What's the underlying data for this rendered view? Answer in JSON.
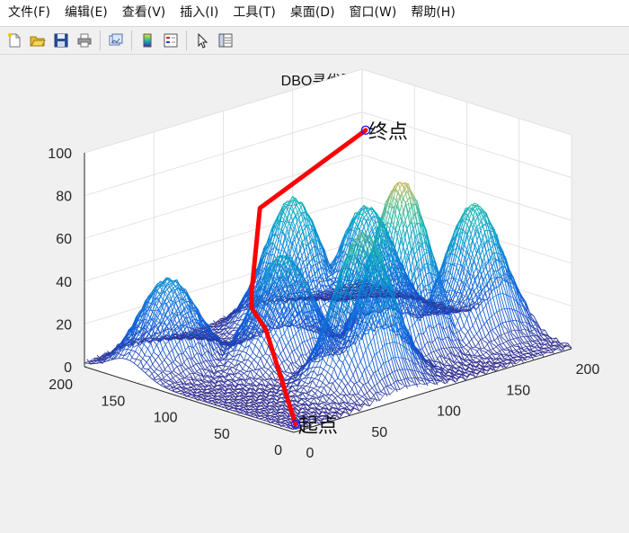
{
  "menu": [
    {
      "id": "file",
      "label": "文件(F)"
    },
    {
      "id": "edit",
      "label": "编辑(E)"
    },
    {
      "id": "view",
      "label": "查看(V)"
    },
    {
      "id": "insert",
      "label": "插入(I)"
    },
    {
      "id": "tools",
      "label": "工具(T)"
    },
    {
      "id": "desktop",
      "label": "桌面(D)"
    },
    {
      "id": "window",
      "label": "窗口(W)"
    },
    {
      "id": "help",
      "label": "帮助(H)"
    }
  ],
  "toolbar": {
    "buttons": [
      "new-figure-icon",
      "open-file-icon",
      "save-icon",
      "print-icon",
      "link-plot-icon",
      "colorbar-icon",
      "legend-icon",
      "pointer-icon",
      "property-editor-icon"
    ]
  },
  "colors": {
    "path": "#ff0000",
    "marker": "#1a1aff"
  },
  "chart_data": {
    "type": "surface3d",
    "title": "DBO寻优路径",
    "xlabel": "",
    "ylabel": "",
    "zlabel": "",
    "xlim": [
      0,
      200
    ],
    "ylim": [
      0,
      200
    ],
    "zlim": [
      0,
      100
    ],
    "x_ticks": [
      "0",
      "50",
      "100",
      "150",
      "200"
    ],
    "y_ticks": [
      "0",
      "50",
      "100",
      "150",
      "200"
    ],
    "z_ticks": [
      "0",
      "20",
      "40",
      "60",
      "80",
      "100"
    ],
    "grid": true,
    "colormap": "parula",
    "peaks": [
      {
        "x": 80,
        "y": 40,
        "height": 70
      },
      {
        "x": 130,
        "y": 70,
        "height": 80
      },
      {
        "x": 75,
        "y": 110,
        "height": 50
      },
      {
        "x": 150,
        "y": 130,
        "height": 55
      },
      {
        "x": 120,
        "y": 160,
        "height": 60
      },
      {
        "x": 30,
        "y": 160,
        "height": 40
      },
      {
        "x": 175,
        "y": 60,
        "height": 62
      }
    ],
    "path": [
      {
        "x": 5,
        "y": 5,
        "z": 2
      },
      {
        "x": 10,
        "y": 40,
        "z": 40
      },
      {
        "x": 30,
        "y": 80,
        "z": 40
      },
      {
        "x": 60,
        "y": 120,
        "z": 35
      },
      {
        "x": 100,
        "y": 165,
        "z": 60
      },
      {
        "x": 195,
        "y": 190,
        "z": 74
      }
    ],
    "annotations": [
      {
        "text": "起点",
        "x": 5,
        "y": 5,
        "z": 2
      },
      {
        "text": "终点",
        "x": 195,
        "y": 190,
        "z": 74
      }
    ]
  }
}
